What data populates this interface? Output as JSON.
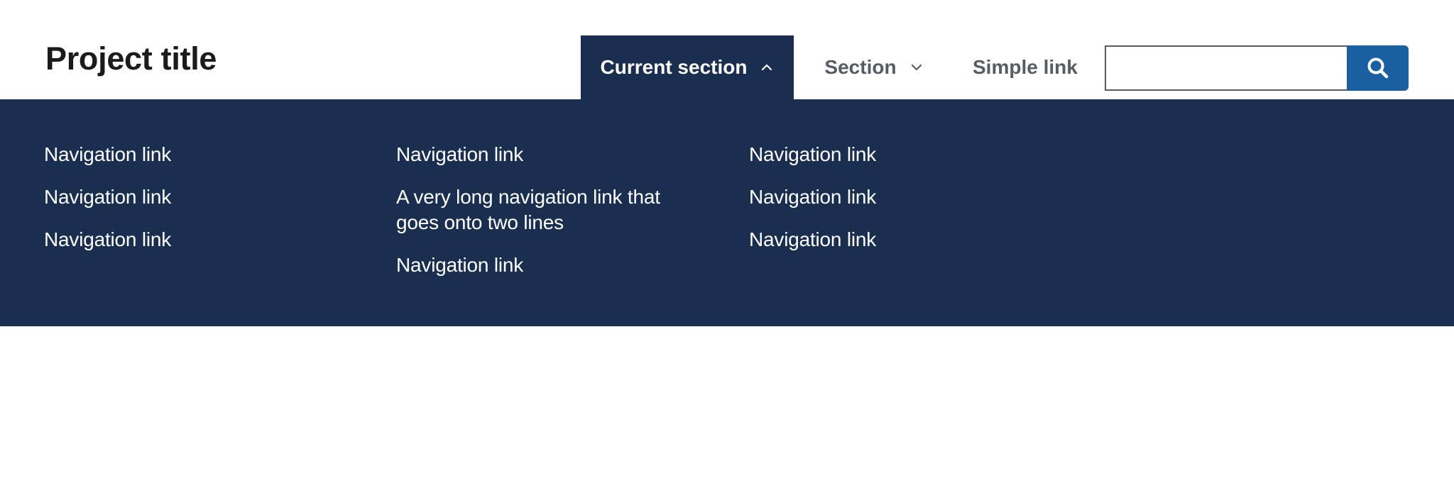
{
  "header": {
    "project_title": "Project title"
  },
  "nav": {
    "items": [
      {
        "label": "Current section",
        "icon": "chevron-up-icon",
        "expanded": true
      },
      {
        "label": "Section",
        "icon": "chevron-down-icon",
        "expanded": false
      },
      {
        "label": "Simple link"
      }
    ]
  },
  "search": {
    "value": "",
    "placeholder": "",
    "button_icon": "search-icon"
  },
  "megamenu": {
    "columns": [
      [
        "Navigation link",
        "Navigation link",
        "Navigation link"
      ],
      [
        "Navigation link",
        "A very long navigation link that goes onto two lines",
        "Navigation link"
      ],
      [
        "Navigation link",
        "Navigation link",
        "Navigation link"
      ]
    ]
  },
  "colors": {
    "dark_navy": "#1a2e50",
    "primary_blue": "#1a5fa0",
    "nav_text_gray": "#565c65",
    "title_text": "#1b1b1b"
  }
}
